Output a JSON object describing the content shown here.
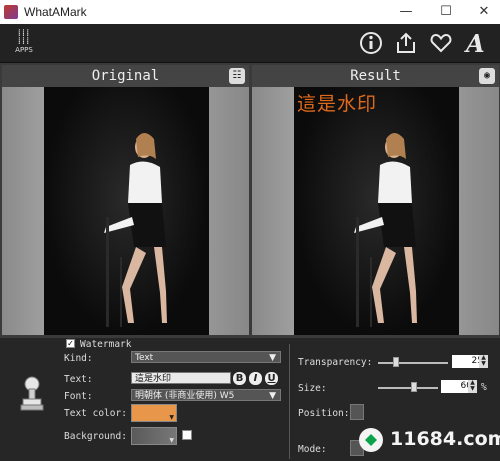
{
  "window": {
    "title": "WhatAMark",
    "minimize": "—",
    "maximize": "☐",
    "close": "✕"
  },
  "toolbar": {
    "apps_label": "APPS",
    "icons": [
      "info-icon",
      "share-icon",
      "heart-icon",
      "font-icon"
    ]
  },
  "panels": {
    "original_label": "Original",
    "result_label": "Result",
    "watermark_preview_text": "這是水印"
  },
  "settings": {
    "section_label": "Watermark",
    "section_checked": true,
    "kind_label": "Kind:",
    "kind_value": "Text",
    "text_label": "Text:",
    "text_value": "這是水印",
    "bold": "B",
    "italic": "I",
    "underline": "U",
    "font_label": "Font:",
    "font_value": "明朝体 (非商业使用) W5",
    "text_color_label": "Text color:",
    "text_color": "#e8964a",
    "background_label": "Background:",
    "transparency_label": "Transparency:",
    "transparency_value": "25",
    "size_label": "Size:",
    "size_value": "60",
    "size_unit": "%",
    "position_label": "Position:",
    "mode_label": "Mode:"
  },
  "site_watermark": {
    "text": "11684.com"
  }
}
